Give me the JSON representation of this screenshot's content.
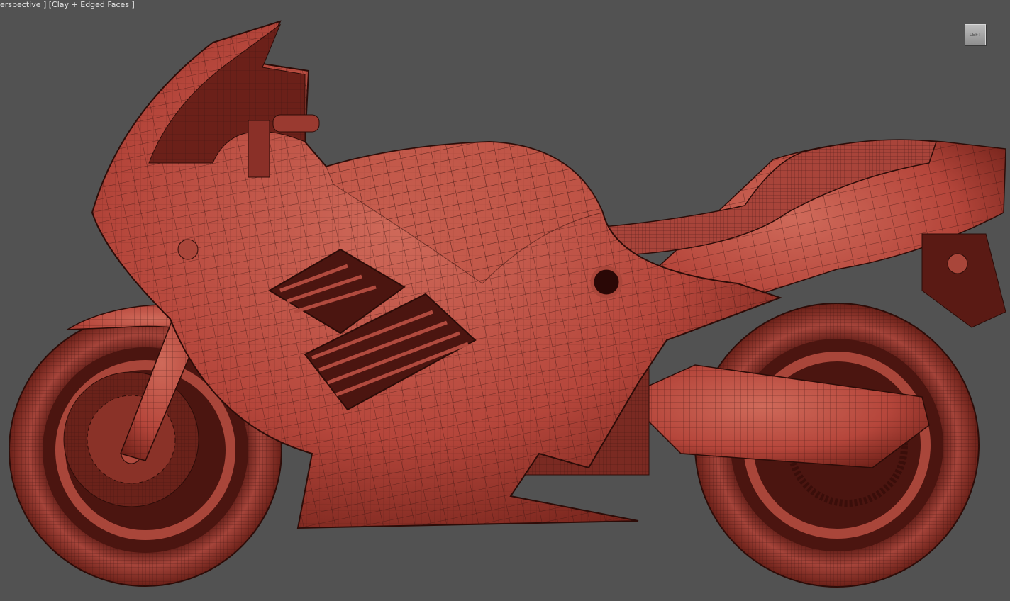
{
  "viewport": {
    "label": "erspective ] [Clay + Edged Faces ]",
    "viewcube_face": "LEFT",
    "background_color": "#525252",
    "model_color": "#b5463b",
    "wire_color": "#3b1410"
  },
  "scene": {
    "subject": "motorcycle",
    "shading": "clay-with-edged-faces"
  }
}
